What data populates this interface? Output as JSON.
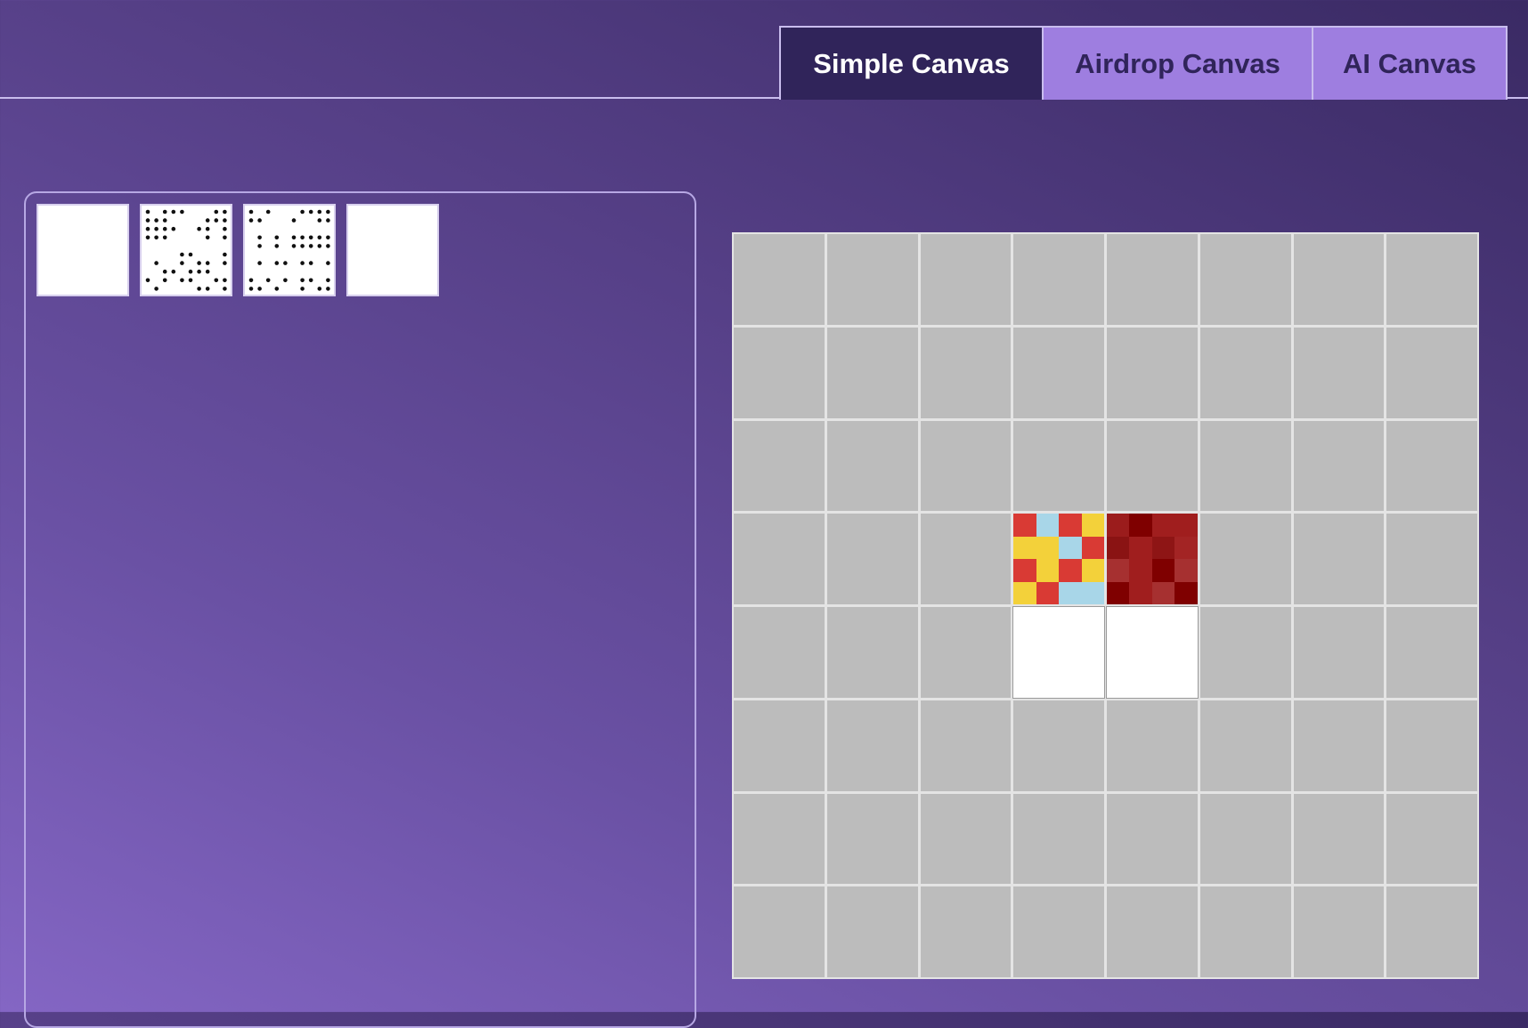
{
  "tabs": [
    {
      "label": "Simple Canvas",
      "active": true
    },
    {
      "label": "Airdrop Canvas",
      "active": false
    },
    {
      "label": "AI Canvas",
      "active": false
    }
  ],
  "colors": {
    "board_empty": "#bcbcbc",
    "board_grid": "#e4e4e4",
    "tab_active_bg": "#30245a",
    "tab_inactive_bg": "#9e7ee0"
  },
  "tray": {
    "tiles": [
      {
        "type": "blank"
      },
      {
        "type": "dots",
        "rows": [
          "1011100011",
          "1110000111",
          "1111001101",
          "1110000101",
          "0000000000",
          "0000110001",
          "0100101101",
          "0011011100",
          "1010110011",
          "0100001101"
        ]
      },
      {
        "type": "dots",
        "rows": [
          "1010001111",
          "1100010011",
          "0000000000",
          "0101011111",
          "0101011111",
          "0000000000",
          "0101101101",
          "0000000000",
          "1010101101",
          "1101001011"
        ]
      },
      {
        "type": "blank"
      }
    ]
  },
  "board": {
    "rows": 8,
    "cols": 8,
    "special": [
      {
        "row": 3,
        "col": 3,
        "type": "pattern",
        "pixels": [
          "#d93a34",
          "#a8d6e8",
          "#d93a34",
          "#f3d13a",
          "#f3d13a",
          "#f3d13a",
          "#a8d6e8",
          "#d93a34",
          "#d93a34",
          "#f3d13a",
          "#d93a34",
          "#f3d13a",
          "#f3d13a",
          "#d93a34",
          "#a8d6e8",
          "#a8d6e8"
        ]
      },
      {
        "row": 3,
        "col": 4,
        "type": "pattern",
        "pixels": [
          "#9b1c1c",
          "#7f0000",
          "#a01e1e",
          "#a01e1e",
          "#8a1313",
          "#a01e1e",
          "#8e1515",
          "#a32424",
          "#a63030",
          "#a01e1e",
          "#7f0000",
          "#a63030",
          "#7f0000",
          "#a01e1e",
          "#a63030",
          "#7f0000"
        ]
      },
      {
        "row": 4,
        "col": 3,
        "type": "white"
      },
      {
        "row": 4,
        "col": 4,
        "type": "white"
      }
    ]
  }
}
